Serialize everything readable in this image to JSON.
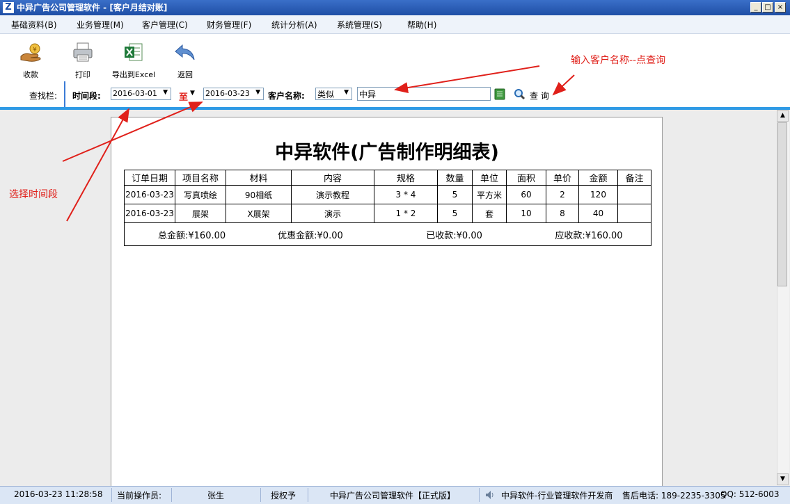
{
  "window": {
    "title": "中异广告公司管理软件 - [客户月结对账]",
    "app_icon_letter": "Z",
    "min_glyph": "_",
    "restore_glyph": "□",
    "close_glyph": "×"
  },
  "menu": [
    "基础资料(B)",
    "业务管理(M)",
    "客户管理(C)",
    "财务管理(F)",
    "统计分析(A)",
    "系统管理(S)",
    "帮助(H)"
  ],
  "toolbar": {
    "collect_label": "收款",
    "print_label": "打印",
    "export_label": "导出到Excel",
    "back_label": "返回"
  },
  "annotations": {
    "customer_hint": "输入客户名称--点查询",
    "time_hint": "选择时间段"
  },
  "search": {
    "bar_label": "查找栏:",
    "period_label": "时间段:",
    "start_date": "2016-03-01",
    "to_label": "至",
    "end_date": "2016-03-23",
    "customer_label": "客户名称:",
    "match_mode": "类似",
    "customer_value": "中异",
    "query_label": "查 询",
    "dropdown_glyph": "▼"
  },
  "report": {
    "title": "中异软件(广告制作明细表)",
    "columns": [
      "订单日期",
      "项目名称",
      "材料",
      "内容",
      "规格",
      "数量",
      "单位",
      "面积",
      "单价",
      "金额",
      "备注"
    ],
    "rows": [
      [
        "2016-03-23",
        "写真喷绘",
        "90相纸",
        "演示教程",
        "3 * 4",
        "5",
        "平方米",
        "60",
        "2",
        "120",
        ""
      ],
      [
        "2016-03-23",
        "展架",
        "X展架",
        "演示",
        "1 * 2",
        "5",
        "套",
        "10",
        "8",
        "40",
        ""
      ]
    ],
    "summary": {
      "total": "总金额:¥160.00",
      "discount": "优惠金额:¥0.00",
      "received": "已收款:¥0.00",
      "receivable": "应收款:¥160.00"
    }
  },
  "statusbar": {
    "datetime": "2016-03-23 11:28:58",
    "operator_label": "当前操作员:",
    "operator": "张生",
    "license": "授权予",
    "edition": "中异广告公司管理软件【正式版】",
    "vendor": "中异软件-行业管理软件开发商",
    "phone": "售后电话: 189-2235-3305",
    "qq": "QQ: 512-6003"
  },
  "colors": {
    "annotation_red": "#e0201a",
    "title_bar_blue": "#1f4fa6",
    "accent_blue": "#2f9ae5"
  }
}
